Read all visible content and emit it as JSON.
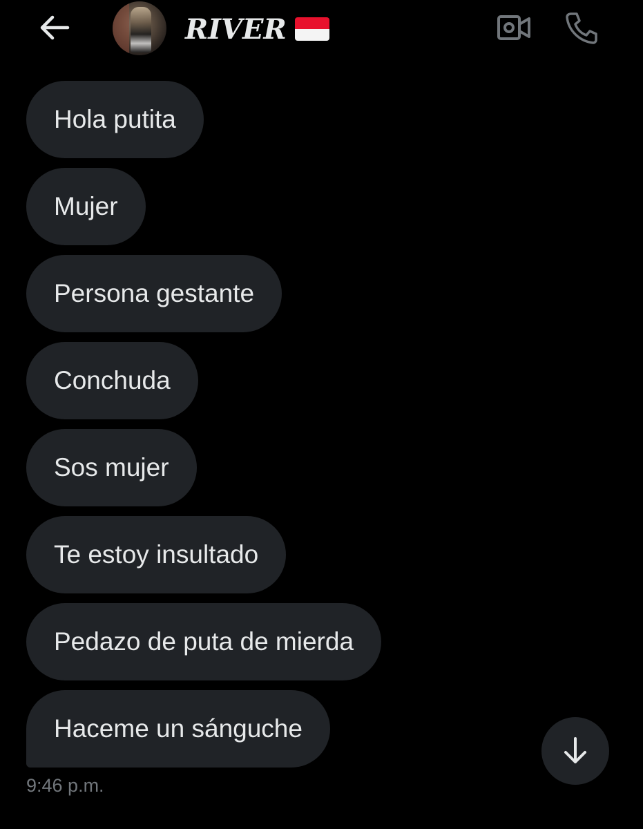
{
  "header": {
    "contact_name": "RIVER",
    "back_icon": "arrow-left-icon",
    "video_icon": "video-camera-icon",
    "call_icon": "phone-icon",
    "flag_icon": "indonesia-flag-icon"
  },
  "messages": [
    {
      "text": "Hola putita"
    },
    {
      "text": "Mujer"
    },
    {
      "text": "Persona gestante"
    },
    {
      "text": "Conchuda"
    },
    {
      "text": "Sos mujer"
    },
    {
      "text": "Te estoy insultado"
    },
    {
      "text": "Pedazo de puta de mierda"
    },
    {
      "text": "Haceme un sánguche"
    }
  ],
  "timestamp": "9:46 p.m.",
  "scroll_icon": "arrow-down-icon",
  "colors": {
    "background": "#000000",
    "bubble": "#202327",
    "text": "#e7e9ea",
    "muted": "#71767b"
  }
}
